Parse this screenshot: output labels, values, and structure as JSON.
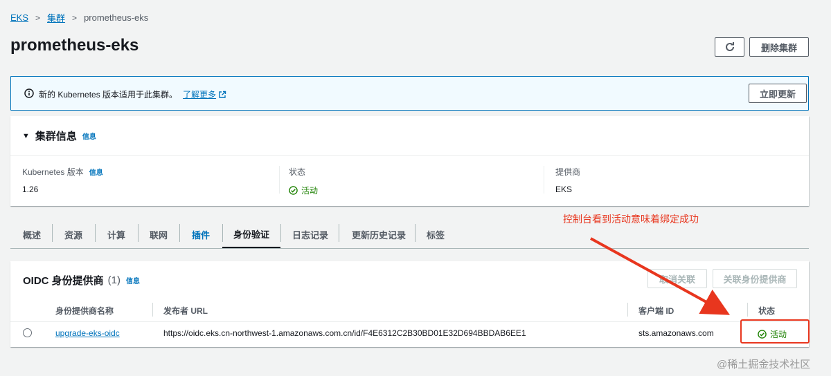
{
  "breadcrumb": {
    "root": "EKS",
    "clusters": "集群",
    "current": "prometheus-eks"
  },
  "page_title": "prometheus-eks",
  "header_actions": {
    "delete_label": "删除集群"
  },
  "banner": {
    "text": "新的 Kubernetes 版本适用于此集群。",
    "link": "了解更多",
    "update_label": "立即更新"
  },
  "cluster_info": {
    "title": "集群信息",
    "info_link": "信息",
    "version_label": "Kubernetes 版本",
    "version_info": "信息",
    "version_value": "1.26",
    "status_label": "状态",
    "status_value": "活动",
    "provider_label": "提供商",
    "provider_value": "EKS"
  },
  "tabs": [
    "概述",
    "资源",
    "计算",
    "联网",
    "插件",
    "身份验证",
    "日志记录",
    "更新历史记录",
    "标签"
  ],
  "annotation": {
    "text": "控制台看到活动意味着绑定成功"
  },
  "oidc": {
    "title": "OIDC 身份提供商",
    "count": "(1)",
    "info_link": "信息",
    "detach_label": "取消关联",
    "attach_label": "关联身份提供商",
    "columns": {
      "name": "身份提供商名称",
      "issuer": "发布者 URL",
      "client": "客户端 ID",
      "status": "状态"
    },
    "row": {
      "name": "upgrade-eks-oidc",
      "issuer": "https://oidc.eks.cn-northwest-1.amazonaws.com.cn/id/F4E6312C2B30BD01E32D694BBDAB6EE1",
      "client": "sts.amazonaws.com",
      "status": "活动"
    }
  },
  "watermark": "@稀土掘金技术社区",
  "colors": {
    "link": "#0073bb",
    "success": "#1d8102",
    "annotation": "#e8361e",
    "banner_bg": "#f1faff"
  },
  "icons": [
    "refresh-icon",
    "info-icon",
    "external-link-icon",
    "caret-down-icon",
    "check-circle-icon"
  ]
}
